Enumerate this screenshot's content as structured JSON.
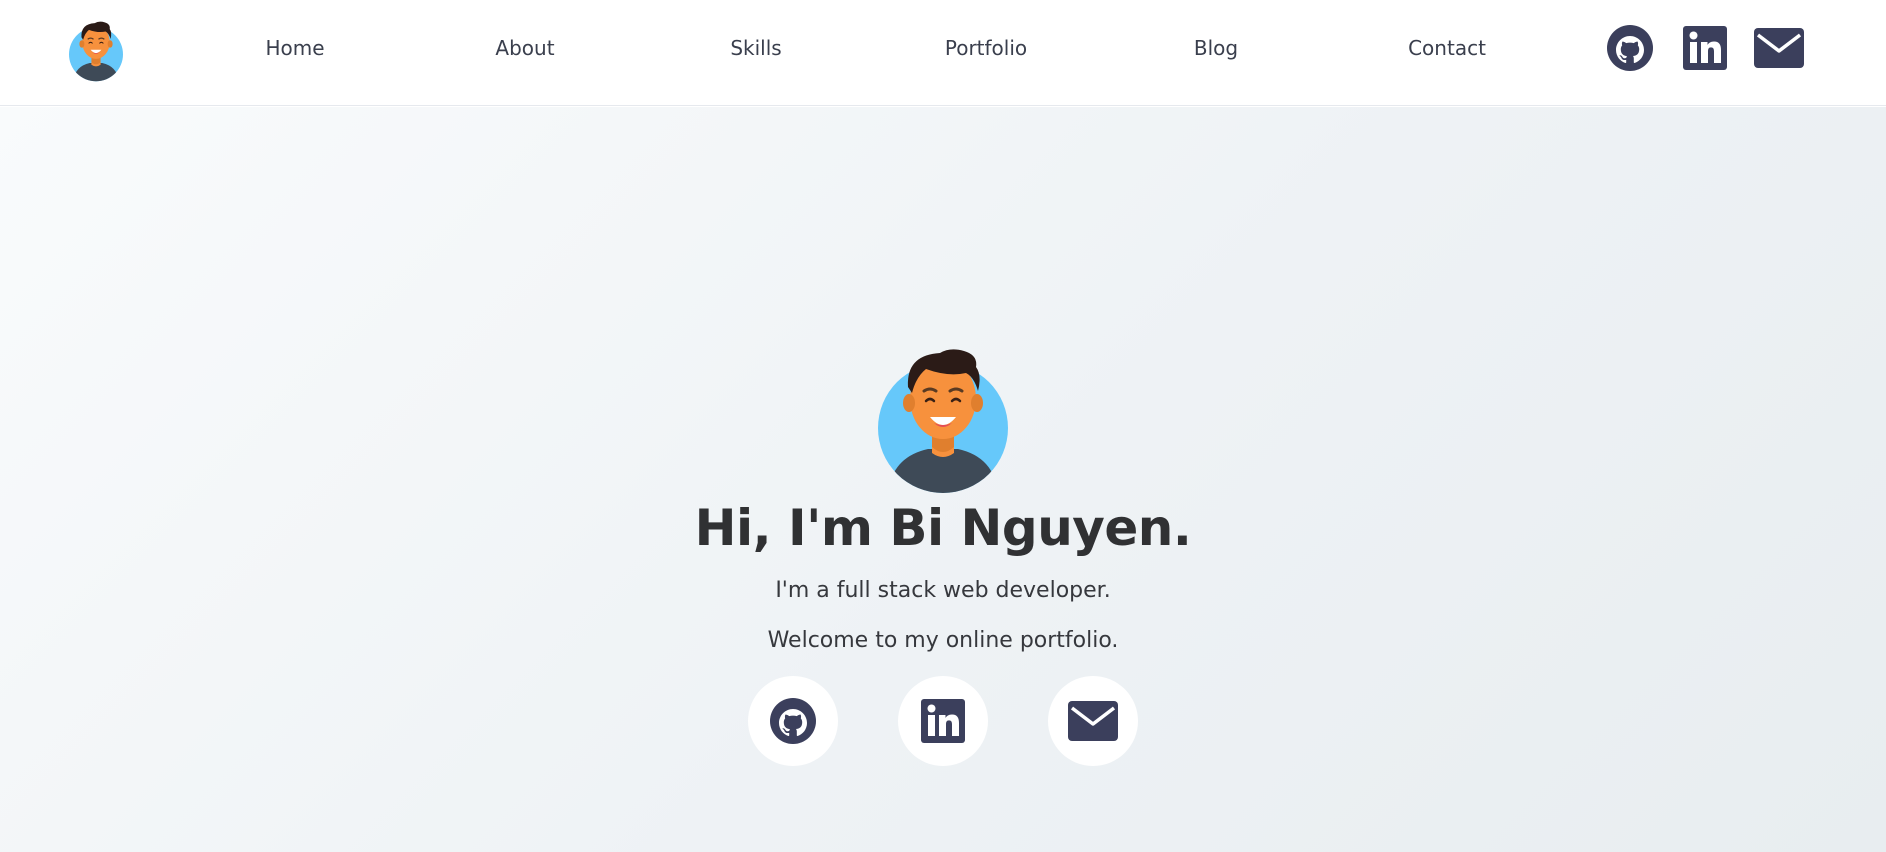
{
  "nav": {
    "logo_name": "avatar-logo",
    "links": [
      {
        "label": "Home"
      },
      {
        "label": "About"
      },
      {
        "label": "Skills"
      },
      {
        "label": "Portfolio"
      },
      {
        "label": "Blog"
      },
      {
        "label": "Contact"
      }
    ],
    "social": [
      {
        "icon": "github-icon"
      },
      {
        "icon": "linkedin-icon"
      },
      {
        "icon": "mail-icon"
      }
    ]
  },
  "hero": {
    "title": "Hi, I'm Bi Nguyen.",
    "line1": "I'm a full stack web developer.",
    "line2": "Welcome to my online portfolio.",
    "buttons": [
      {
        "icon": "github-icon"
      },
      {
        "icon": "linkedin-icon"
      },
      {
        "icon": "mail-icon"
      }
    ]
  },
  "colors": {
    "icon": "#3b3f5c",
    "text": "#303133",
    "avatar_bg": "#66c8fa",
    "skin": "#f7913d",
    "hair": "#2b1b17",
    "shirt": "#3e4a57"
  }
}
